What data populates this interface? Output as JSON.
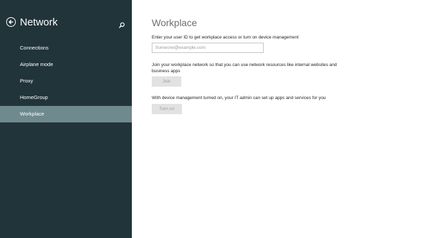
{
  "sidebar": {
    "title": "Network",
    "items": [
      {
        "label": "Connections"
      },
      {
        "label": "Airplane mode"
      },
      {
        "label": "Proxy"
      },
      {
        "label": "HomeGroup"
      },
      {
        "label": "Workplace"
      }
    ],
    "selected": "Workplace",
    "colors": {
      "background": "#21343a",
      "selected": "#6f8a8f"
    }
  },
  "main": {
    "title": "Workplace",
    "user_id_label": "Enter your user ID to get workplace access or turn on device management",
    "user_id_placeholder": "Someone@example.com",
    "join_description_line1": "Join your workplace network so that you can use network resources like internal websites and",
    "join_description_line2": "business apps",
    "join_button": "Join",
    "device_mgmt_description": "With device management turned on, your IT admin can set up apps and services for you",
    "turn_on_button": "Turn on"
  }
}
